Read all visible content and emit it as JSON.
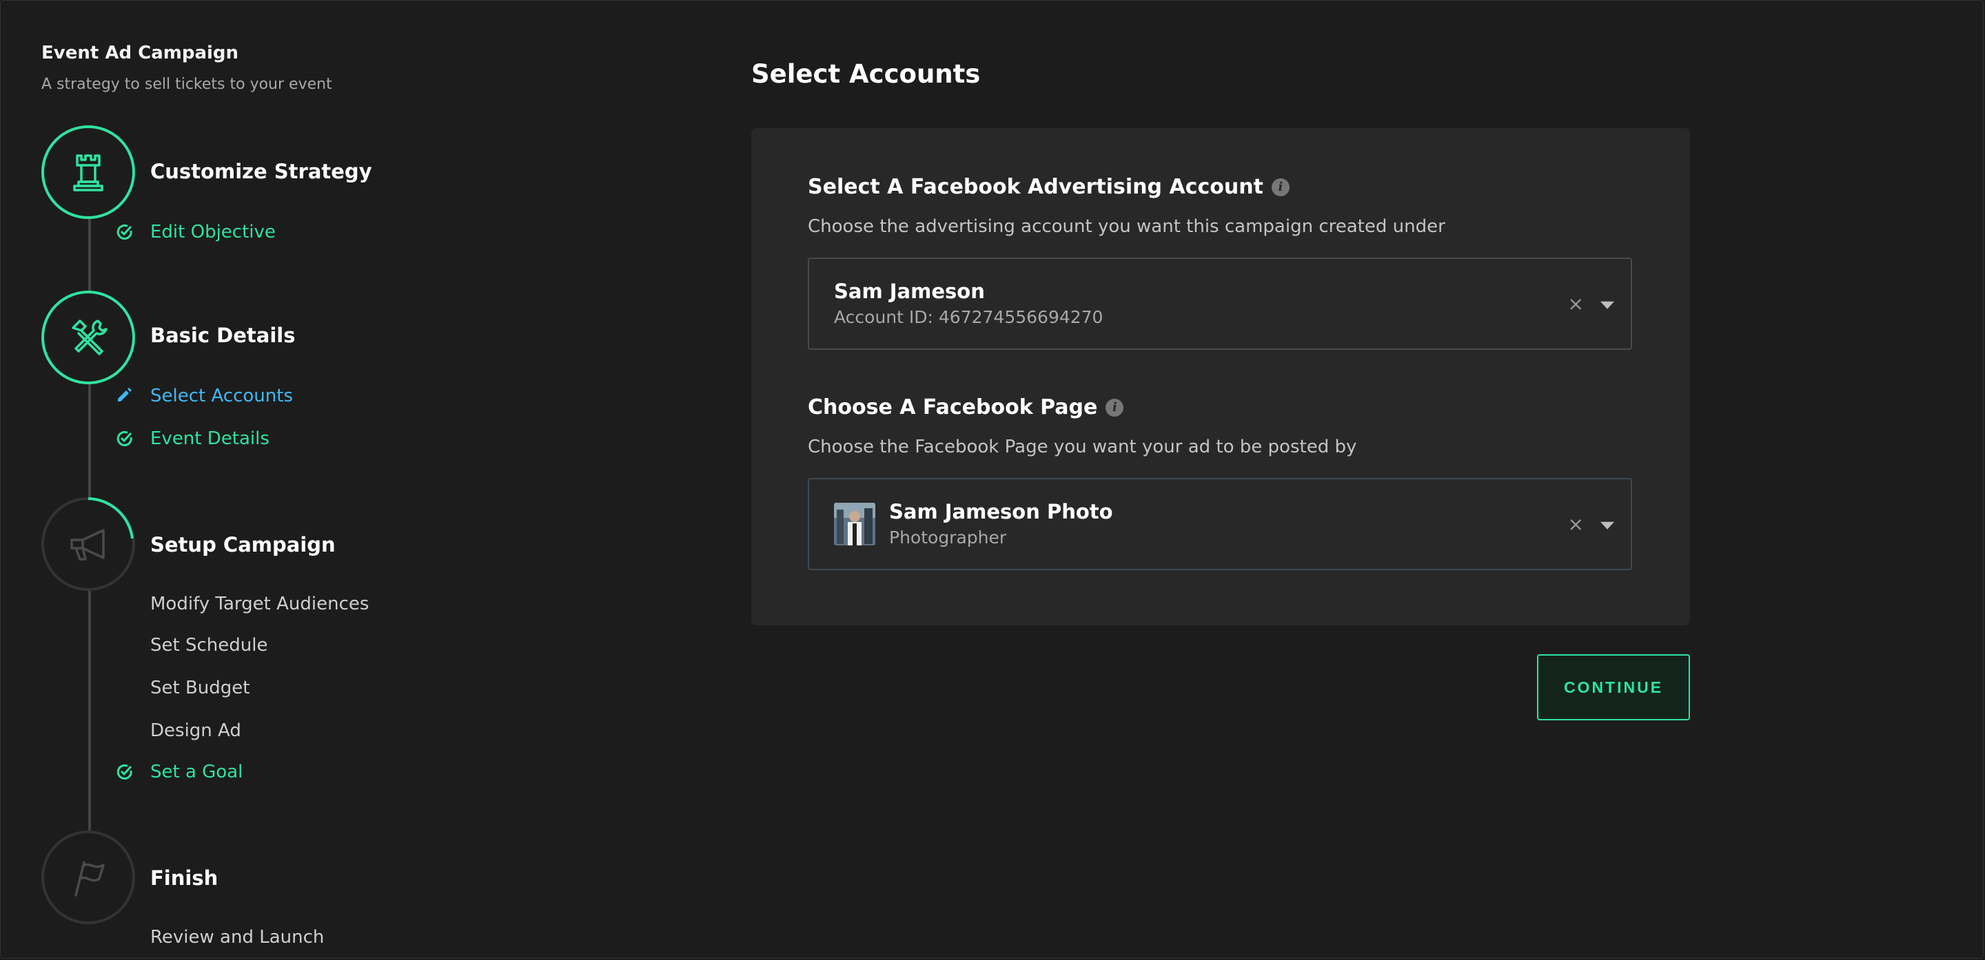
{
  "campaign": {
    "title": "Event Ad Campaign",
    "subtitle": "A strategy to sell tickets to your event"
  },
  "steps": [
    {
      "title": "Customize Strategy",
      "icon": "rook-icon",
      "status": "done",
      "items": [
        {
          "label": "Edit Objective",
          "state": "done"
        }
      ]
    },
    {
      "title": "Basic Details",
      "icon": "tools-icon",
      "status": "done",
      "items": [
        {
          "label": "Select Accounts",
          "state": "active"
        },
        {
          "label": "Event Details",
          "state": "done"
        }
      ]
    },
    {
      "title": "Setup Campaign",
      "icon": "megaphone-icon",
      "status": "in-progress",
      "items": [
        {
          "label": "Modify Target Audiences",
          "state": "todo"
        },
        {
          "label": "Set Schedule",
          "state": "todo"
        },
        {
          "label": "Set Budget",
          "state": "todo"
        },
        {
          "label": "Design Ad",
          "state": "todo"
        },
        {
          "label": "Set a Goal",
          "state": "done"
        }
      ]
    },
    {
      "title": "Finish",
      "icon": "flag-icon",
      "status": "pending",
      "items": [
        {
          "label": "Review and Launch",
          "state": "todo"
        }
      ]
    }
  ],
  "main": {
    "title": "Select Accounts",
    "ad_account": {
      "label": "Select A Facebook Advertising Account",
      "description": "Choose the advertising account you want this campaign created under",
      "name": "Sam Jameson",
      "meta": "Account ID: 467274556694270",
      "clear_glyph": "×"
    },
    "page": {
      "label": "Choose A Facebook Page",
      "description": "Choose the Facebook Page you want your ad to be posted by",
      "name": "Sam Jameson Photo",
      "meta": "Photographer",
      "clear_glyph": "×"
    },
    "continue_label": "CONTINUE"
  },
  "colors": {
    "background": "#1c1c1c",
    "card": "#282828",
    "accent_green": "#2fe3a0",
    "accent_blue": "#3fb9f5"
  }
}
